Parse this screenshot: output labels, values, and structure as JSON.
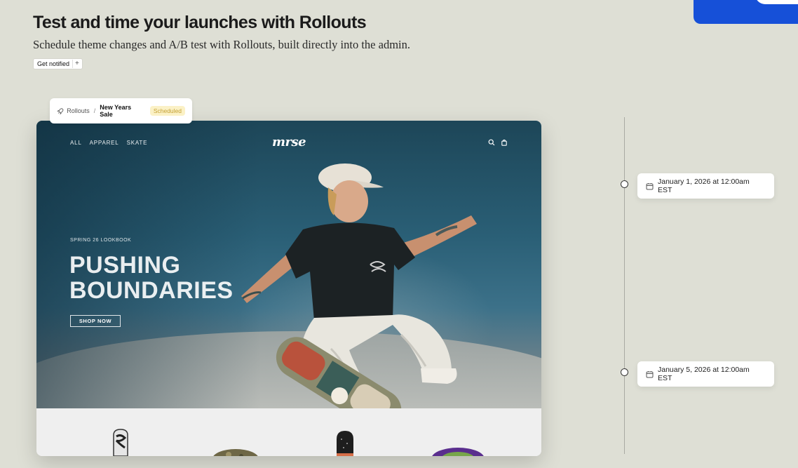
{
  "header": {
    "title": "Test and time your launches with Rollouts",
    "subtitle": "Schedule theme changes and A/B test with Rollouts, built directly into the admin.",
    "notify_label": "Get notified",
    "notify_plus": "+"
  },
  "breadcrumb": {
    "icon": "rocket-icon",
    "root": "Rollouts",
    "separator": "/",
    "current": "New Years Sale",
    "status": "Scheduled",
    "status_color": "#c4a136"
  },
  "store": {
    "nav_links": [
      "ALL",
      "APPAREL",
      "SKATE"
    ],
    "logo": "mrse",
    "eyebrow": "SPRING 26 LOOKBOOK",
    "hero_line1": "PUSHING",
    "hero_line2": "BOUNDARIES",
    "cta": "SHOP NOW"
  },
  "timeline": {
    "events": [
      {
        "label": "January 1, 2026 at 12:00am EST"
      },
      {
        "label": "January 5, 2026 at 12:00am EST"
      }
    ]
  },
  "colors": {
    "background": "#dedfd5",
    "accent_blue": "#1650d8"
  }
}
